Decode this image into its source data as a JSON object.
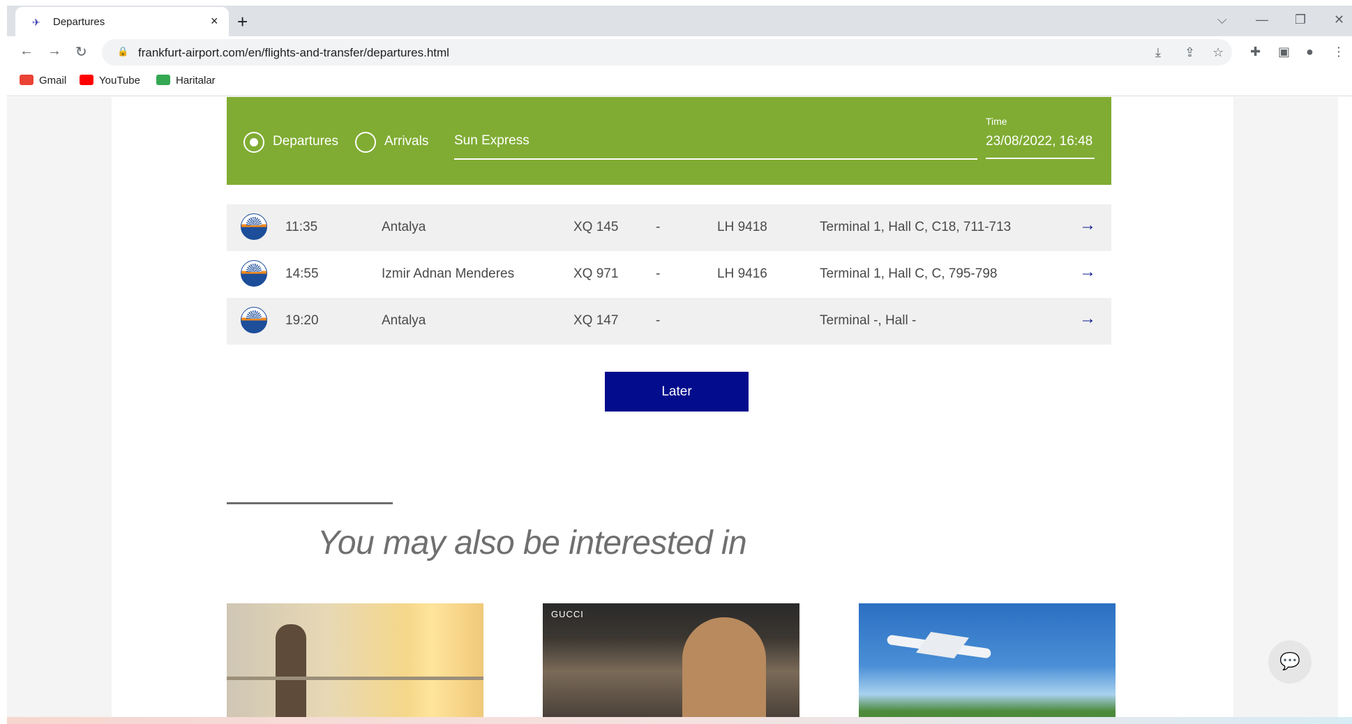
{
  "browser": {
    "tab_title": "Departures",
    "tab_close": "×",
    "new_tab": "+",
    "url": "frankfurt-airport.com/en/flights-and-transfer/departures.html",
    "bookmarks": [
      {
        "label": "Gmail",
        "color": "#ea4335"
      },
      {
        "label": "YouTube",
        "color": "#ff0000"
      },
      {
        "label": "Haritalar",
        "color": "#34a853"
      }
    ]
  },
  "filter": {
    "departures_label": "Departures",
    "arrivals_label": "Arrivals",
    "selected": "Departures",
    "search_value": "Sun Express",
    "time_label": "Time",
    "time_value": "23/08/2022, 16:48",
    "accent_color": "#80ac33"
  },
  "flights": [
    {
      "time": "11:35",
      "destination": "Antalya",
      "flight": "XQ 145",
      "status": "-",
      "codeshare": "LH 9418",
      "location": "Terminal 1, Hall C, C18, 711-713"
    },
    {
      "time": "14:55",
      "destination": "Izmir Adnan Menderes",
      "flight": "XQ 971",
      "status": "-",
      "codeshare": "LH 9416",
      "location": "Terminal 1, Hall C, C, 795-798"
    },
    {
      "time": "19:20",
      "destination": "Antalya",
      "flight": "XQ 147",
      "status": "-",
      "codeshare": "",
      "location": "Terminal -, Hall -"
    }
  ],
  "later_button": "Later",
  "section_title": "You may also be interested in",
  "teasers": [
    {
      "label": ""
    },
    {
      "label": "GUCCI"
    },
    {
      "label": ""
    }
  ]
}
